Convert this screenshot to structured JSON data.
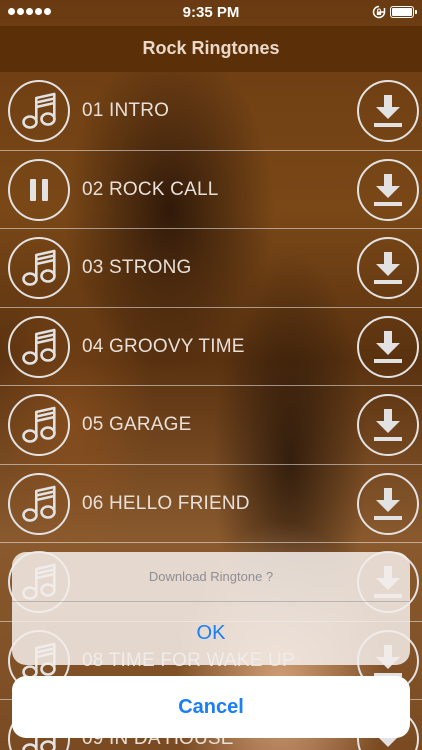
{
  "status_bar": {
    "time": "9:35 PM",
    "signal_icon": "signal-dots-icon",
    "rotation_icon": "rotation-lock-icon",
    "battery_icon": "battery-full-icon"
  },
  "nav": {
    "title": "Rock Ringtones"
  },
  "tracks": [
    {
      "title": "01 INTRO",
      "state": "idle",
      "left_icon": "music-note-icon",
      "right_icon": "download-icon"
    },
    {
      "title": "02 ROCK CALL",
      "state": "playing",
      "left_icon": "pause-icon",
      "right_icon": "download-icon"
    },
    {
      "title": "03 STRONG",
      "state": "idle",
      "left_icon": "music-note-icon",
      "right_icon": "download-icon"
    },
    {
      "title": "04 GROOVY TIME",
      "state": "idle",
      "left_icon": "music-note-icon",
      "right_icon": "download-icon"
    },
    {
      "title": "05 GARAGE",
      "state": "idle",
      "left_icon": "music-note-icon",
      "right_icon": "download-icon"
    },
    {
      "title": "06 HELLO FRIEND",
      "state": "idle",
      "left_icon": "music-note-icon",
      "right_icon": "download-icon"
    },
    {
      "title": "",
      "state": "idle",
      "left_icon": "music-note-icon",
      "right_icon": "download-icon"
    },
    {
      "title": "08 TIME FOR WAKE UP",
      "state": "idle",
      "left_icon": "music-note-icon",
      "right_icon": "download-icon"
    },
    {
      "title": "09 IN DA HOUSE",
      "state": "idle",
      "left_icon": "music-note-icon",
      "right_icon": "download-icon"
    }
  ],
  "action_sheet": {
    "message": "Download Ringtone ?",
    "ok_label": "OK",
    "cancel_label": "Cancel"
  },
  "colors": {
    "nav_bar": "#5b2f08",
    "action_blue": "#1a7ef5",
    "icon_stroke": "#e2e2e2"
  }
}
